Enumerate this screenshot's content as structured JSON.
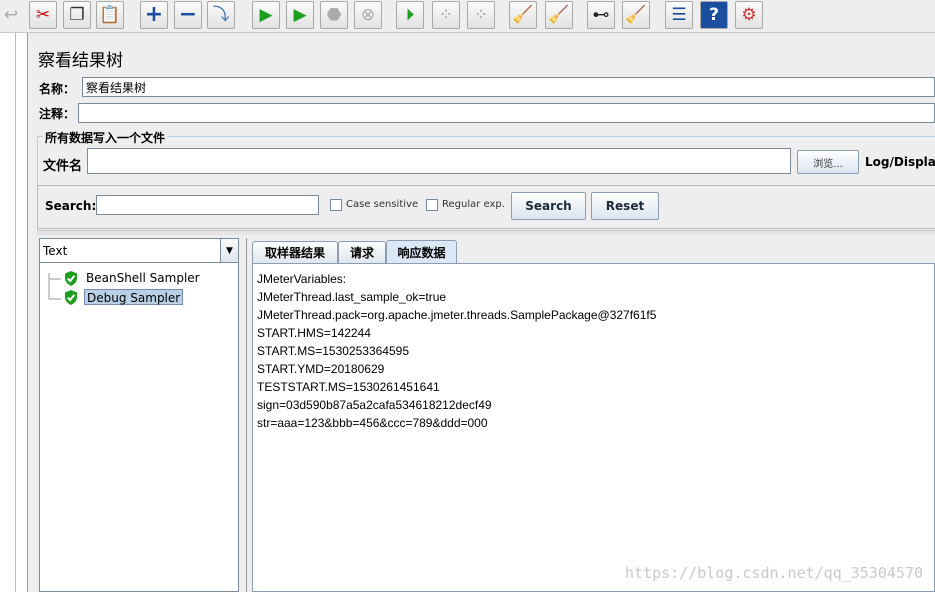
{
  "toolbar": {
    "icons": [
      "cut-icon",
      "copy-icon",
      "paste-icon",
      "expand-icon",
      "collapse-icon",
      "toggle-icon",
      "start-icon",
      "start-no-pause-icon",
      "stop-icon",
      "shutdown-icon",
      "remote-start-icon",
      "remote-stop-icon",
      "remote-shutdown-icon",
      "clear-icon",
      "clear-all-icon",
      "search-icon",
      "reset-search-icon",
      "function-helper-icon",
      "help-icon",
      "logger-icon"
    ]
  },
  "page": {
    "title": "察看结果树"
  },
  "name_field": {
    "label": "名称：",
    "value": "察看结果树"
  },
  "comment_field": {
    "label": "注释：",
    "value": ""
  },
  "file_group": {
    "title": "所有数据写入一个文件",
    "filename_label": "文件名",
    "filename_value": "",
    "browse_label": "浏览...",
    "log_label": "Log/Display O"
  },
  "search": {
    "label": "Search:",
    "value": "",
    "case_sensitive_label": "Case sensitive",
    "case_sensitive_checked": false,
    "regex_label": "Regular exp.",
    "regex_checked": false,
    "search_button": "Search",
    "reset_button": "Reset"
  },
  "tree": {
    "renderer_selected": "Text",
    "items": [
      {
        "label": "BeanShell Sampler",
        "status": "success",
        "selected": false
      },
      {
        "label": "Debug Sampler",
        "status": "success",
        "selected": true
      }
    ]
  },
  "result_tabs": [
    {
      "label": "取样器结果",
      "active": false
    },
    {
      "label": "请求",
      "active": false
    },
    {
      "label": "响应数据",
      "active": true
    }
  ],
  "response_lines": [
    "JMeterVariables:",
    "JMeterThread.last_sample_ok=true",
    "JMeterThread.pack=org.apache.jmeter.threads.SamplePackage@327f61f5",
    "START.HMS=142244",
    "START.MS=1530253364595",
    "START.YMD=20180629",
    "TESTSTART.MS=1530261451641",
    "sign=03d590b87a5a2cafa534618212decf49",
    "str=aaa=123&bbb=456&ccc=789&ddd=000"
  ],
  "watermark": "https://blog.csdn.net/qq_35304570",
  "colors": {
    "success": "#1e9e1e",
    "selection": "#b8cfe5",
    "accent": "#1a4fa0"
  }
}
